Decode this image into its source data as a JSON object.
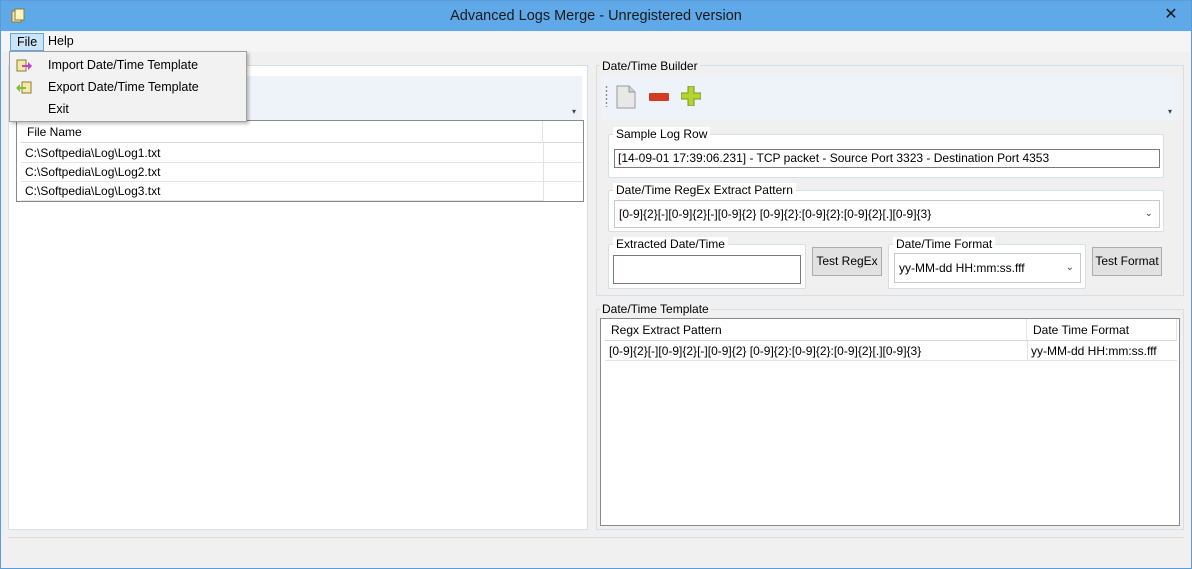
{
  "window": {
    "title": "Advanced Logs Merge - Unregistered version",
    "close_glyph": "✕"
  },
  "menubar": {
    "file": "File",
    "help": "Help"
  },
  "file_menu": {
    "items": [
      {
        "label": "Import Date/Time Template",
        "icon": "import-icon"
      },
      {
        "label": "Export Date/Time Template",
        "icon": "export-icon"
      },
      {
        "label": "Exit",
        "icon": ""
      }
    ]
  },
  "files_grid": {
    "header": "File Name",
    "rows": [
      "C:\\Softpedia\\Log\\Log1.txt",
      "C:\\Softpedia\\Log\\Log2.txt",
      "C:\\Softpedia\\Log\\Log3.txt"
    ]
  },
  "builder": {
    "group_label": "Date/Time Builder",
    "toolbar_icons": [
      "new-document-icon",
      "remove-icon",
      "add-icon"
    ],
    "sample_log_row": {
      "label": "Sample Log Row",
      "value": "[14-09-01 17:39:06.231] - TCP packet - Source Port 3323 - Destination Port 4353"
    },
    "regex_pattern": {
      "label": "Date/Time RegEx Extract Pattern",
      "value": "[0-9]{2}[-][0-9]{2}[-][0-9]{2} [0-9]{2}:[0-9]{2}:[0-9]{2}[.][0-9]{3}"
    },
    "extracted": {
      "label": "Extracted Date/Time",
      "value": ""
    },
    "test_regex_label": "Test RegEx",
    "format": {
      "label": "Date/Time Format",
      "value": "yy-MM-dd HH:mm:ss.fff"
    },
    "test_format_label": "Test Format"
  },
  "template": {
    "group_label": "Date/Time Template",
    "headers": [
      "Regx Extract Pattern",
      "Date Time Format"
    ],
    "rows": [
      {
        "pattern": "[0-9]{2}[-][0-9]{2}[-][0-9]{2} [0-9]{2}:[0-9]{2}:[0-9]{2}[.][0-9]{3}",
        "format": "yy-MM-dd HH:mm:ss.fff"
      }
    ]
  },
  "colors": {
    "titlebar": "#5fa9e8",
    "menu_highlight": "#cce4f7",
    "toolstrip": "#eef3fa"
  }
}
